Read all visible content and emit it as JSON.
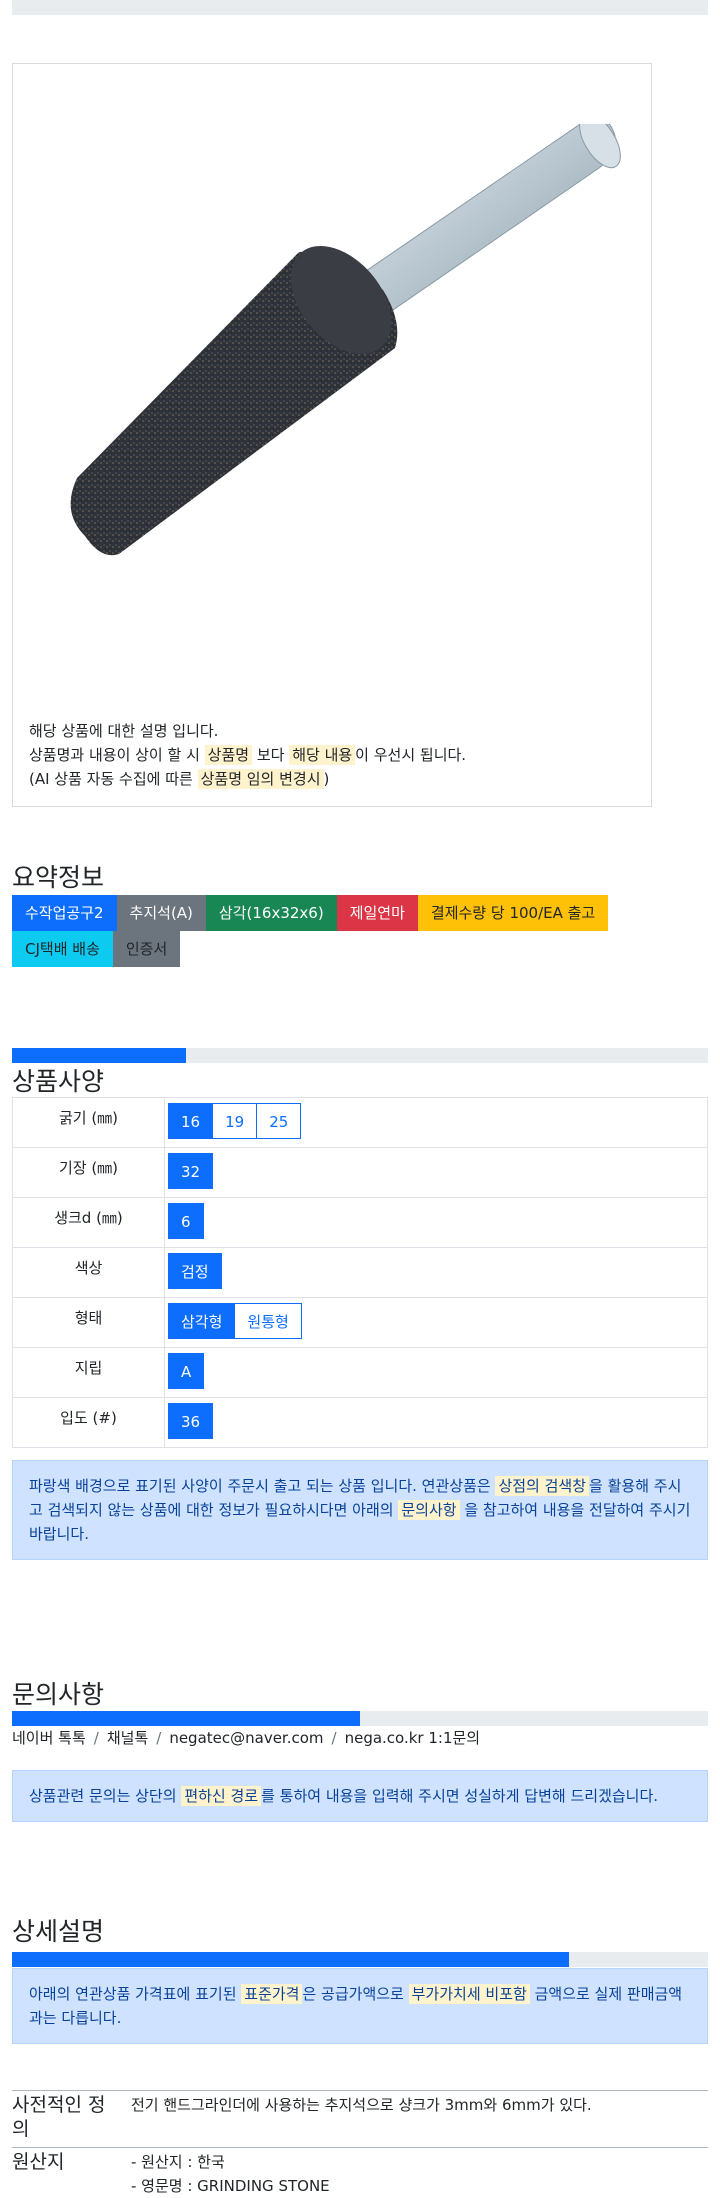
{
  "product": {
    "desc_line1": "해당 상품에 대한 설명 입니다.",
    "desc_line2": {
      "a": "상품명과 내용이 상이 할 시 ",
      "hl1": "상품명",
      "b": " 보다 ",
      "hl2": "해당 내용",
      "c": "이 우선시 됩니다."
    },
    "desc_line3": {
      "a": "(AI 상품 자동 수집에 따른 ",
      "hl1": "상품명 임의 변경시",
      "b": ")"
    }
  },
  "summary": {
    "title": "요약정보",
    "badges": [
      {
        "label": "수작업공구2",
        "color": "#0d6efd"
      },
      {
        "label": "추지석(A)",
        "color": "#6c757d"
      },
      {
        "label": "삼각(16x32x6)",
        "color": "#198754"
      },
      {
        "label": "제일연마",
        "color": "#dc3545"
      },
      {
        "label": "결제수량 당 100/EA 출고",
        "color": "#ffc107"
      },
      {
        "label": "CJ택배 배송",
        "color": "#0dcaf0"
      },
      {
        "label": "인증서",
        "color": "#6c757d"
      }
    ]
  },
  "specs": {
    "title": "상품사양",
    "progress": 0.25,
    "rows": [
      {
        "label": "굵기 (㎜)",
        "options": [
          "16",
          "19",
          "25"
        ]
      },
      {
        "label": "기장 (㎜)",
        "options": [
          "32"
        ]
      },
      {
        "label": "생크d (㎜)",
        "options": [
          "6"
        ]
      },
      {
        "label": "색상",
        "options": [
          "검정"
        ]
      },
      {
        "label": "형태",
        "options": [
          "삼각형",
          "원통형"
        ]
      },
      {
        "label": "지립",
        "options": [
          "A"
        ]
      },
      {
        "label": "입도 (#)",
        "options": [
          "36"
        ]
      }
    ],
    "notice": {
      "a": "파랑색 배경으로 표기된 사양이 주문시 출고 되는 상품 입니다. 연관상품은 ",
      "hl1": "상점의 검색창",
      "b": "을 활용해 주시고 검색되지 않는 상품에 대한 정보가 필요하시다면 아래의 ",
      "hl2": "문의사항",
      "c": " 을 참고하여 내용을 전달하여 주시기 바랍니다."
    }
  },
  "inquiry": {
    "title": "문의사항",
    "progress": 0.5,
    "breadcrumb": [
      "네이버 톡톡",
      "채널톡",
      "negatec@naver.com",
      "nega.co.kr 1:1문의"
    ],
    "notice": {
      "a": "상품관련 문의는 상단의 ",
      "hl1": "편하신 경로",
      "b": "를 통하여 내용을 입력해 주시면 성실하게 답변해 드리겠습니다."
    }
  },
  "detail": {
    "title": "상세설명",
    "progress": 0.8,
    "notice": {
      "a": "아래의 연관상품 가격표에 표기된 ",
      "hl1": "표준가격",
      "b": "은 공급가액으로 ",
      "hl2": "부가가치세 비포함",
      "c": " 금액으로 실제 판매금액과는 다릅니다."
    },
    "definition_key": "사전적인 정의",
    "definition_val": "전기 핸드그라인더에 사용하는 추지석으로 샹크가 3mm와 6mm가 있다.",
    "origin_key": "원산지",
    "origin_lines": [
      "- 원산지 : 한국",
      "- 영문명 : GRINDING STONE"
    ]
  }
}
